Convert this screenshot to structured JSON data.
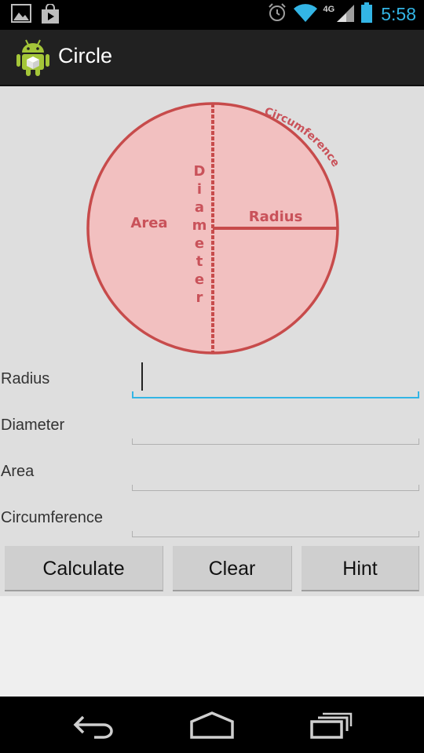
{
  "status_bar": {
    "time": "5:58",
    "network_label": "4G",
    "icons": [
      "gallery-icon",
      "shopping-bag-icon",
      "alarm-icon",
      "wifi-icon",
      "signal-icon",
      "battery-icon"
    ]
  },
  "action_bar": {
    "title": "Circle",
    "icon": "android-robot-icon"
  },
  "diagram": {
    "labels": {
      "area": "Area",
      "radius": "Radius",
      "diameter": [
        "D",
        "i",
        "a",
        "m",
        "e",
        "t",
        "e",
        "r"
      ],
      "circumference": "Circumference"
    },
    "colors": {
      "fill": "#f2c0c0",
      "stroke": "#c74b4b",
      "text": "#c9525a"
    }
  },
  "form": {
    "radius": {
      "label": "Radius",
      "value": ""
    },
    "diameter": {
      "label": "Diameter",
      "value": ""
    },
    "area": {
      "label": "Area",
      "value": ""
    },
    "circumference": {
      "label": "Circumference",
      "value": ""
    }
  },
  "buttons": {
    "calculate": "Calculate",
    "clear": "Clear",
    "hint": "Hint"
  },
  "nav_bar": {
    "icons": [
      "back-icon",
      "home-icon",
      "recent-apps-icon"
    ]
  },
  "colors": {
    "accent": "#33b5e5",
    "content_bg": "#dedede",
    "button_bg": "#cfcfcf"
  }
}
